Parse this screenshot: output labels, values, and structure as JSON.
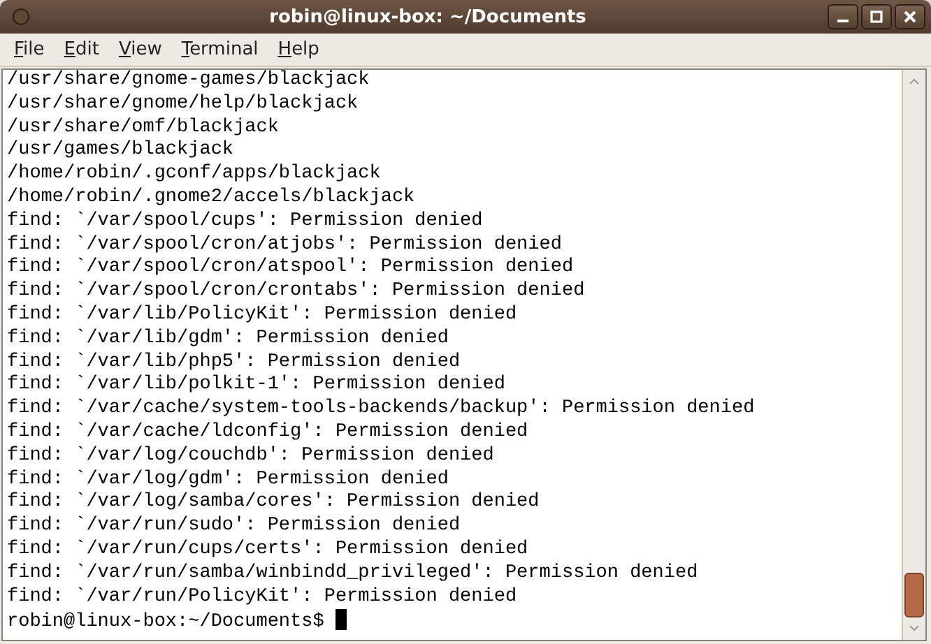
{
  "window": {
    "title": "robin@linux-box: ~/Documents"
  },
  "menu": [
    "File",
    "Edit",
    "View",
    "Terminal",
    "Help"
  ],
  "terminal": {
    "lines": [
      "/usr/share/gnome-games/blackjack",
      "/usr/share/gnome/help/blackjack",
      "/usr/share/omf/blackjack",
      "/usr/games/blackjack",
      "/home/robin/.gconf/apps/blackjack",
      "/home/robin/.gnome2/accels/blackjack",
      "find: `/var/spool/cups': Permission denied",
      "find: `/var/spool/cron/atjobs': Permission denied",
      "find: `/var/spool/cron/atspool': Permission denied",
      "find: `/var/spool/cron/crontabs': Permission denied",
      "find: `/var/lib/PolicyKit': Permission denied",
      "find: `/var/lib/gdm': Permission denied",
      "find: `/var/lib/php5': Permission denied",
      "find: `/var/lib/polkit-1': Permission denied",
      "find: `/var/cache/system-tools-backends/backup': Permission denied",
      "find: `/var/cache/ldconfig': Permission denied",
      "find: `/var/log/couchdb': Permission denied",
      "find: `/var/log/gdm': Permission denied",
      "find: `/var/log/samba/cores': Permission denied",
      "find: `/var/run/sudo': Permission denied",
      "find: `/var/run/cups/certs': Permission denied",
      "find: `/var/run/samba/winbindd_privileged': Permission denied",
      "find: `/var/run/PolicyKit': Permission denied"
    ],
    "prompt": "robin@linux-box:~/Documents$"
  }
}
